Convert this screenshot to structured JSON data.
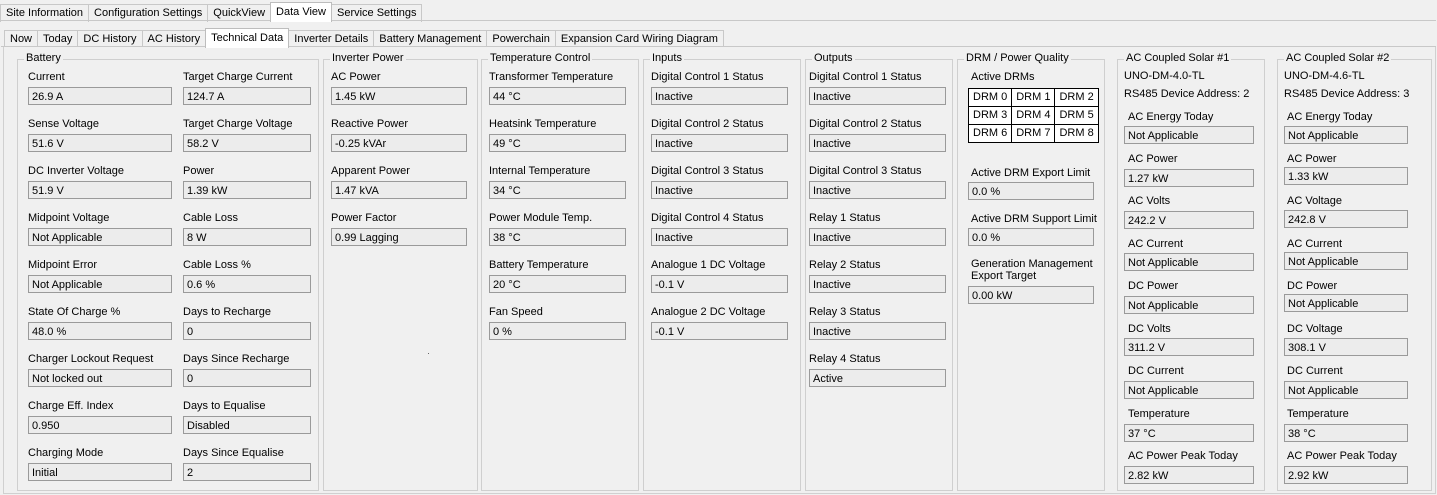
{
  "top_tabs": [
    "Site Information",
    "Configuration Settings",
    "QuickView",
    "Data View",
    "Service Settings"
  ],
  "top_tabs_active": "Data View",
  "sub_tabs": [
    "Now",
    "Today",
    "DC History",
    "AC History",
    "Technical Data",
    "Inverter Details",
    "Battery Management",
    "Powerchain",
    "Expansion Card Wiring Diagram"
  ],
  "sub_tabs_active": "Technical Data",
  "battery": {
    "title": "Battery",
    "fields": [
      {
        "label": "Current",
        "value": "26.9 A"
      },
      {
        "label": "Target Charge Current",
        "value": "124.7 A"
      },
      {
        "label": "Sense Voltage",
        "value": "51.6 V"
      },
      {
        "label": "Target Charge Voltage",
        "value": "58.2 V"
      },
      {
        "label": "DC Inverter Voltage",
        "value": "51.9 V"
      },
      {
        "label": "Power",
        "value": "1.39 kW"
      },
      {
        "label": "Midpoint Voltage",
        "value": "Not Applicable"
      },
      {
        "label": "Cable Loss",
        "value": "8 W"
      },
      {
        "label": "Midpoint Error",
        "value": "Not Applicable"
      },
      {
        "label": "Cable Loss %",
        "value": "0.6 %"
      },
      {
        "label": "State Of Charge %",
        "value": "48.0 %"
      },
      {
        "label": "Days to Recharge",
        "value": "0"
      },
      {
        "label": "Charger Lockout Request",
        "value": "Not locked out"
      },
      {
        "label": "Days Since Recharge",
        "value": "0"
      },
      {
        "label": "Charge Eff. Index",
        "value": "0.950"
      },
      {
        "label": "Days to Equalise",
        "value": "Disabled"
      },
      {
        "label": "Charging Mode",
        "value": "Initial"
      },
      {
        "label": "Days Since Equalise",
        "value": "2"
      }
    ]
  },
  "inverter_power": {
    "title": "Inverter Power",
    "fields": [
      {
        "label": "AC Power",
        "value": "1.45 kW"
      },
      {
        "label": "Reactive Power",
        "value": "-0.25 kVAr"
      },
      {
        "label": "Apparent Power",
        "value": "1.47 kVA"
      },
      {
        "label": "Power Factor",
        "value": "0.99 Lagging"
      }
    ]
  },
  "temperature_control": {
    "title": "Temperature Control",
    "fields": [
      {
        "label": "Transformer Temperature",
        "value": "44 °C"
      },
      {
        "label": "Heatsink Temperature",
        "value": "49 °C"
      },
      {
        "label": "Internal Temperature",
        "value": "34 °C"
      },
      {
        "label": "Power Module Temp.",
        "value": "38 °C"
      },
      {
        "label": "Battery Temperature",
        "value": "20 °C"
      },
      {
        "label": "Fan Speed",
        "value": "0 %"
      }
    ]
  },
  "inputs": {
    "title": "Inputs",
    "fields": [
      {
        "label": "Digital Control 1 Status",
        "value": "Inactive"
      },
      {
        "label": "Digital Control 2 Status",
        "value": "Inactive"
      },
      {
        "label": "Digital Control 3 Status",
        "value": "Inactive"
      },
      {
        "label": "Digital Control 4 Status",
        "value": "Inactive"
      },
      {
        "label": "Analogue 1 DC Voltage",
        "value": "-0.1 V"
      },
      {
        "label": "Analogue 2 DC Voltage",
        "value": "-0.1 V"
      }
    ]
  },
  "outputs": {
    "title": "Outputs",
    "fields": [
      {
        "label": "Digital Control 1 Status",
        "value": "Inactive"
      },
      {
        "label": "Digital Control 2 Status",
        "value": "Inactive"
      },
      {
        "label": "Digital Control 3 Status",
        "value": "Inactive"
      },
      {
        "label": "Relay 1 Status",
        "value": "Inactive"
      },
      {
        "label": "Relay 2 Status",
        "value": "Inactive"
      },
      {
        "label": "Relay 3 Status",
        "value": "Inactive"
      },
      {
        "label": "Relay 4 Status",
        "value": "Active"
      }
    ]
  },
  "drm": {
    "title": "DRM / Power Quality",
    "active_drms_label": "Active DRMs",
    "drm_cells": [
      [
        "DRM 0",
        "DRM 1",
        "DRM 2"
      ],
      [
        "DRM 3",
        "DRM 4",
        "DRM 5"
      ],
      [
        "DRM 6",
        "DRM 7",
        "DRM 8"
      ]
    ],
    "export_limit_label": "Active DRM Export Limit",
    "export_limit_value": "0.0 %",
    "support_limit_label": "Active DRM Support Limit",
    "support_limit_value": "0.0 %",
    "gen_mgmt_label_1": "Generation Management",
    "gen_mgmt_label_2": "Export Target",
    "gen_mgmt_value": "0.00 kW"
  },
  "ac_solar_1": {
    "title": "AC Coupled Solar #1",
    "model": "UNO-DM-4.0-TL",
    "address": "RS485 Device Address: 2",
    "fields": [
      {
        "label": "AC Energy Today",
        "value": "Not Applicable"
      },
      {
        "label": "AC Power",
        "value": "1.27 kW"
      },
      {
        "label": "AC Volts",
        "value": "242.2 V"
      },
      {
        "label": "AC Current",
        "value": "Not Applicable"
      },
      {
        "label": "DC Power",
        "value": "Not Applicable"
      },
      {
        "label": "DC Volts",
        "value": "311.2 V"
      },
      {
        "label": "DC Current",
        "value": "Not Applicable"
      },
      {
        "label": "Temperature",
        "value": "37 °C"
      },
      {
        "label": "AC Power Peak Today",
        "value": "2.82 kW"
      }
    ]
  },
  "ac_solar_2": {
    "title": "AC Coupled Solar #2",
    "model": "UNO-DM-4.6-TL",
    "address": "RS485 Device Address: 3",
    "fields": [
      {
        "label": "AC Energy Today",
        "value": "Not Applicable"
      },
      {
        "label": "AC Power",
        "value": "1.33 kW"
      },
      {
        "label": "AC Voltage",
        "value": "242.8 V"
      },
      {
        "label": "AC Current",
        "value": "Not Applicable"
      },
      {
        "label": "DC Power",
        "value": "Not Applicable"
      },
      {
        "label": "DC Voltage",
        "value": "308.1 V"
      },
      {
        "label": "DC Current",
        "value": "Not Applicable"
      },
      {
        "label": "Temperature",
        "value": "38 °C"
      },
      {
        "label": "AC Power Peak Today",
        "value": "2.92 kW"
      }
    ]
  }
}
